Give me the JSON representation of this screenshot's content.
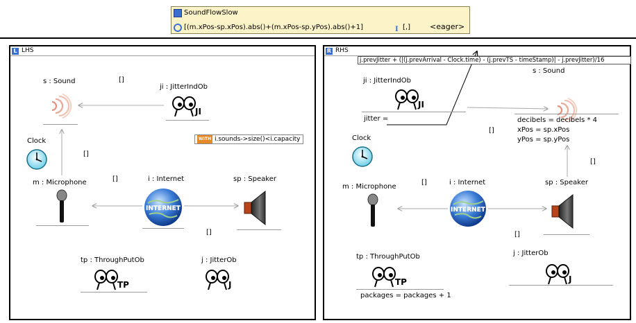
{
  "rule": {
    "name": "SoundFlowSlow",
    "condition": "[(m.xPos-sp.xPos).abs()+(m.xPos-sp.yPos).abs()+1]",
    "params": "[,]",
    "priority": "<eager>"
  },
  "lhs": {
    "title": "LHS",
    "badge": "L",
    "nodes": {
      "s": "s : Sound",
      "ji": "ji : JitterIndOb",
      "clock": "Clock",
      "m": "m : Microphone",
      "i": "i : Internet",
      "sp": "sp : Speaker",
      "tp": "tp : ThroughPutOb",
      "j": "j : JitterOb"
    },
    "links": [
      "[]",
      "[]",
      "[]",
      "[]"
    ],
    "constraint": {
      "tag": "WITH",
      "text": "i.sounds->size()<i.capacity"
    },
    "badges": {
      "ji": "JI",
      "tp": "TP",
      "j": "J"
    }
  },
  "rhs": {
    "title": "RHS",
    "badge": "R",
    "formula": "j.prevJitter + (|(j.prevArrival - Clock.time) - (j.prevTS - timeStamp)| - j.prevJitter)/16",
    "nodes": {
      "s": "s : Sound",
      "ji": "ji : JitterIndOb",
      "clock": "Clock",
      "m": "m : Microphone",
      "i": "i : Internet",
      "sp": "sp : Speaker",
      "tp": "tp : ThroughPutOb",
      "j": "j : JitterOb"
    },
    "attributes": {
      "jitter": "jitter =",
      "decibels": "decibels = decibels * 4",
      "xPos": "xPos = sp.xPos",
      "yPos": "yPos = sp.yPos",
      "packages": "packages = packages + 1"
    },
    "links": [
      "[]",
      "[]",
      "[]",
      "[]"
    ],
    "badges": {
      "ji": "JI",
      "tp": "TP",
      "j": "J"
    }
  },
  "icons": [
    "rule-icon",
    "condition-icon",
    "parameter-icon",
    "sound-icon",
    "clock-icon",
    "microphone-icon",
    "internet-icon",
    "speaker-icon",
    "eyes-icon"
  ],
  "colors": {
    "header_bg": "#fdf3c8",
    "accent": "#3a6fd0"
  }
}
